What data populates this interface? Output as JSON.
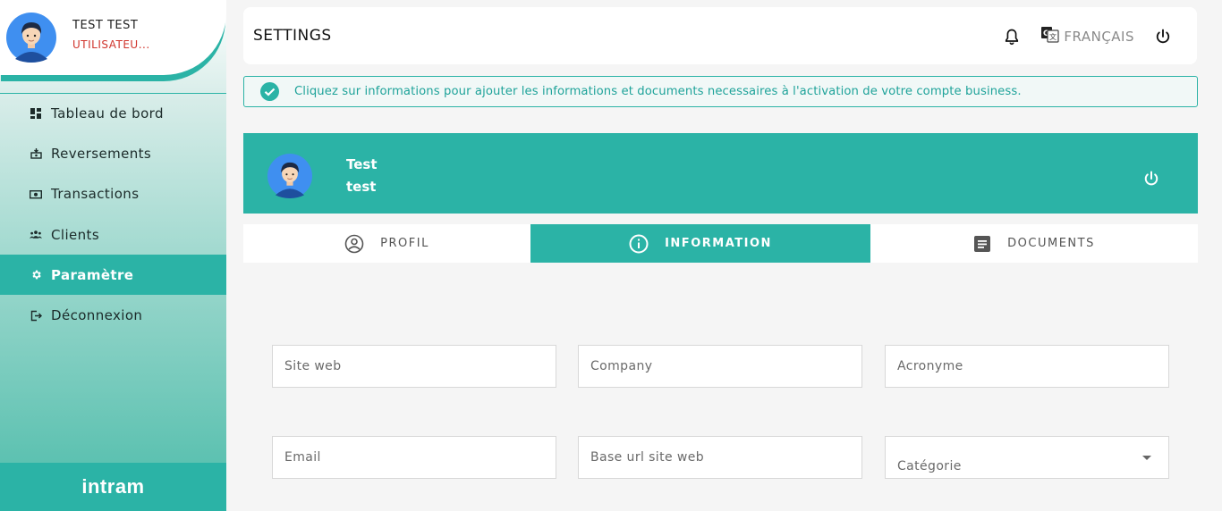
{
  "colors": {
    "accent": "#2bb3a6",
    "alert_text": "#1fa39a",
    "role_text": "#d0342c"
  },
  "user": {
    "name": "TEST TEST",
    "role": "UTILISATEU..."
  },
  "sidebar": {
    "items": [
      {
        "label": "Tableau de bord",
        "icon": "dashboard-icon"
      },
      {
        "label": "Reversements",
        "icon": "payout-icon"
      },
      {
        "label": "Transactions",
        "icon": "money-icon"
      },
      {
        "label": "Clients",
        "icon": "users-icon"
      },
      {
        "label": "Paramètre",
        "icon": "gear-icon",
        "active": true
      },
      {
        "label": "Déconnexion",
        "icon": "logout-icon"
      }
    ],
    "logo": "intram"
  },
  "header": {
    "title": "SETTINGS",
    "language": "FRANÇAIS"
  },
  "alert": {
    "message": "Cliquez sur informations pour ajouter les informations et documents necessaires à l'activation de votre compte business."
  },
  "profile_banner": {
    "first_name": "Test",
    "last_name": "test"
  },
  "tabs": [
    {
      "label": "PROFIL",
      "icon": "account-circle-icon"
    },
    {
      "label": "INFORMATION",
      "icon": "info-icon",
      "active": true
    },
    {
      "label": "DOCUMENTS",
      "icon": "document-icon"
    }
  ],
  "form": {
    "site_web": {
      "placeholder": "Site web",
      "value": ""
    },
    "company": {
      "placeholder": "Company",
      "value": ""
    },
    "acronyme": {
      "placeholder": "Acronyme",
      "value": ""
    },
    "email": {
      "placeholder": "Email",
      "value": ""
    },
    "base_url": {
      "placeholder": "Base url site web",
      "value": ""
    },
    "categorie": {
      "label": "Catégorie",
      "value": ""
    }
  }
}
